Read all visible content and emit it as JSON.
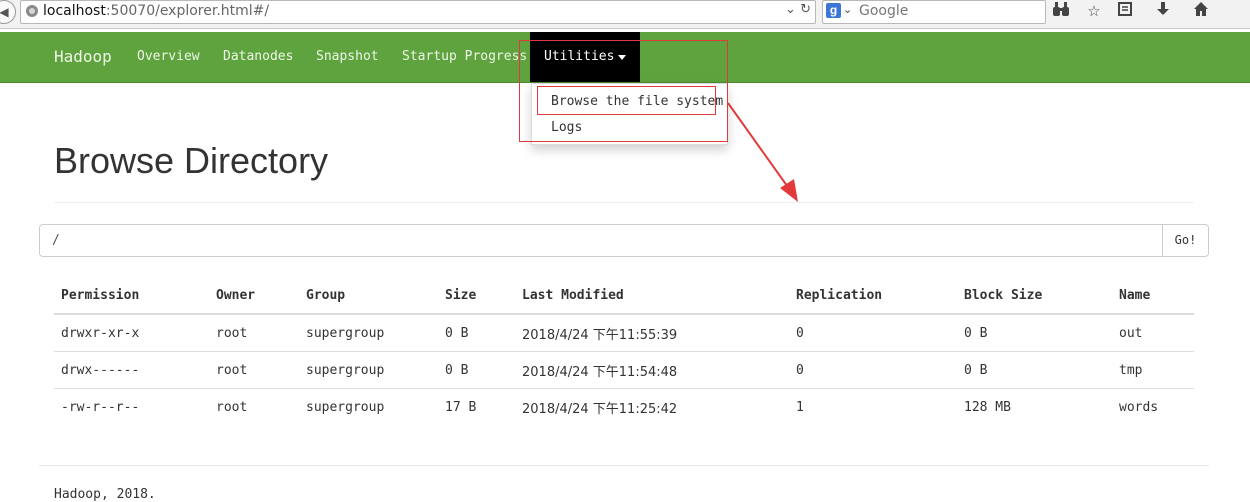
{
  "browser": {
    "url_host": "localhost",
    "url_rest": ":50070/explorer.html#/",
    "search_engine_letter": "g",
    "search_placeholder": "Google"
  },
  "navbar": {
    "brand": "Hadoop",
    "items": [
      "Overview",
      "Datanodes",
      "Snapshot",
      "Startup Progress"
    ],
    "active": "Utilities",
    "background": "#5fa33e"
  },
  "dropdown": {
    "items": [
      "Browse the file system",
      "Logs"
    ]
  },
  "page": {
    "title": "Browse Directory",
    "path_value": "/",
    "go_label": "Go!"
  },
  "table": {
    "headers": [
      "Permission",
      "Owner",
      "Group",
      "Size",
      "Last Modified",
      "Replication",
      "Block Size",
      "Name"
    ],
    "rows": [
      [
        "drwxr-xr-x",
        "root",
        "supergroup",
        "0 B",
        "2018/4/24 下午11:55:39",
        "0",
        "0 B",
        "out"
      ],
      [
        "drwx------",
        "root",
        "supergroup",
        "0 B",
        "2018/4/24 下午11:54:48",
        "0",
        "0 B",
        "tmp"
      ],
      [
        "-rw-r--r--",
        "root",
        "supergroup",
        "17 B",
        "2018/4/24 下午11:25:42",
        "1",
        "128 MB",
        "words"
      ]
    ]
  },
  "footer": {
    "text": "Hadoop, 2018."
  }
}
